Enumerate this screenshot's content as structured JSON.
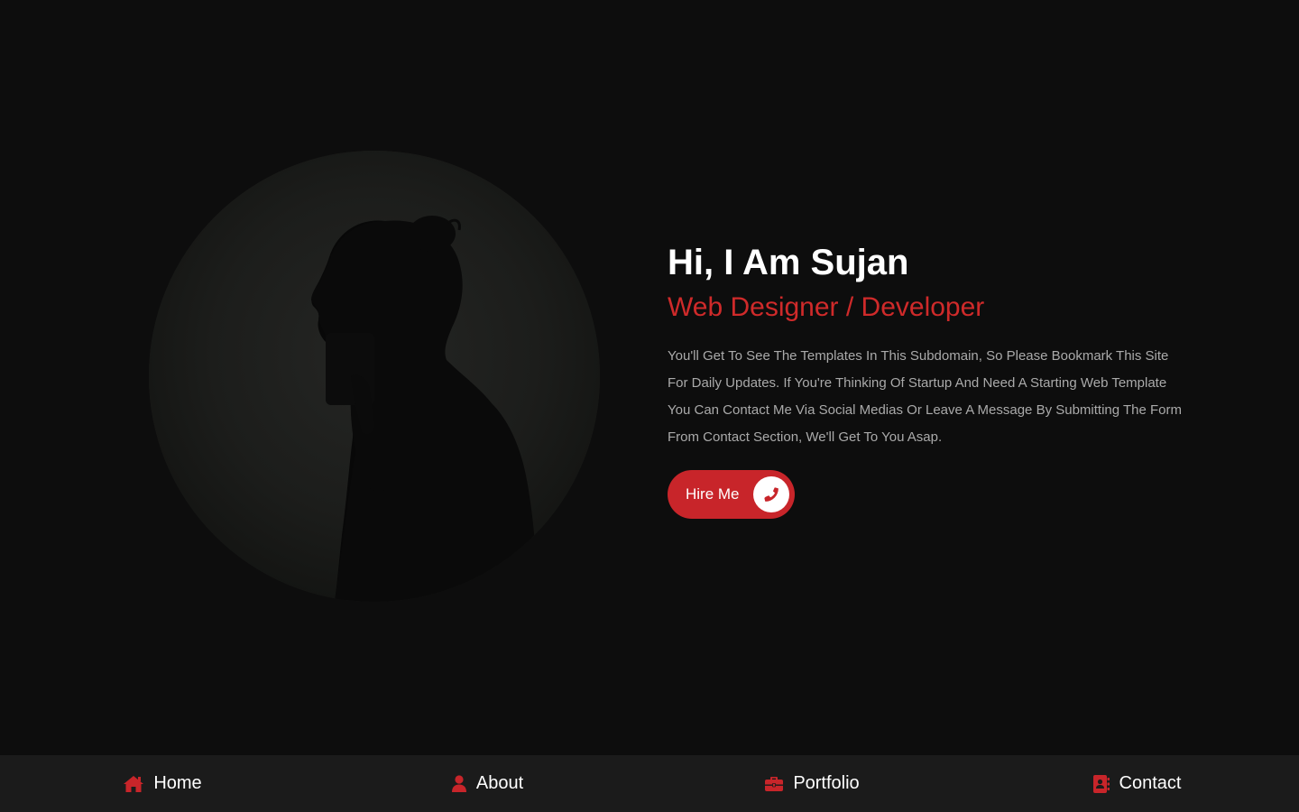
{
  "hero": {
    "greeting": "Hi, I Am Sujan",
    "role": "Web Designer / Developer",
    "bio": "You'll Get To See The Templates In This Subdomain, So Please Bookmark This Site For Daily Updates. If You're Thinking Of Startup And Need A Starting Web Template You Can Contact Me Via Social Medias Or Leave A Message By Submitting The Form From Contact Section, We'll Get To You Asap.",
    "hire_button": {
      "label": "Hire Me",
      "icon": "phone-icon"
    },
    "photo_icon": "profile-photo"
  },
  "nav": {
    "items": [
      {
        "label": "Home",
        "icon": "home-icon"
      },
      {
        "label": "About",
        "icon": "user-icon"
      },
      {
        "label": "Portfolio",
        "icon": "briefcase-icon"
      },
      {
        "label": "Contact",
        "icon": "address-book-icon"
      }
    ]
  },
  "colors": {
    "background": "#0d0d0d",
    "accent": "#c8252a",
    "nav_background": "#1b1b1b",
    "text_primary": "#ffffff",
    "text_muted": "#aaaaaa"
  }
}
